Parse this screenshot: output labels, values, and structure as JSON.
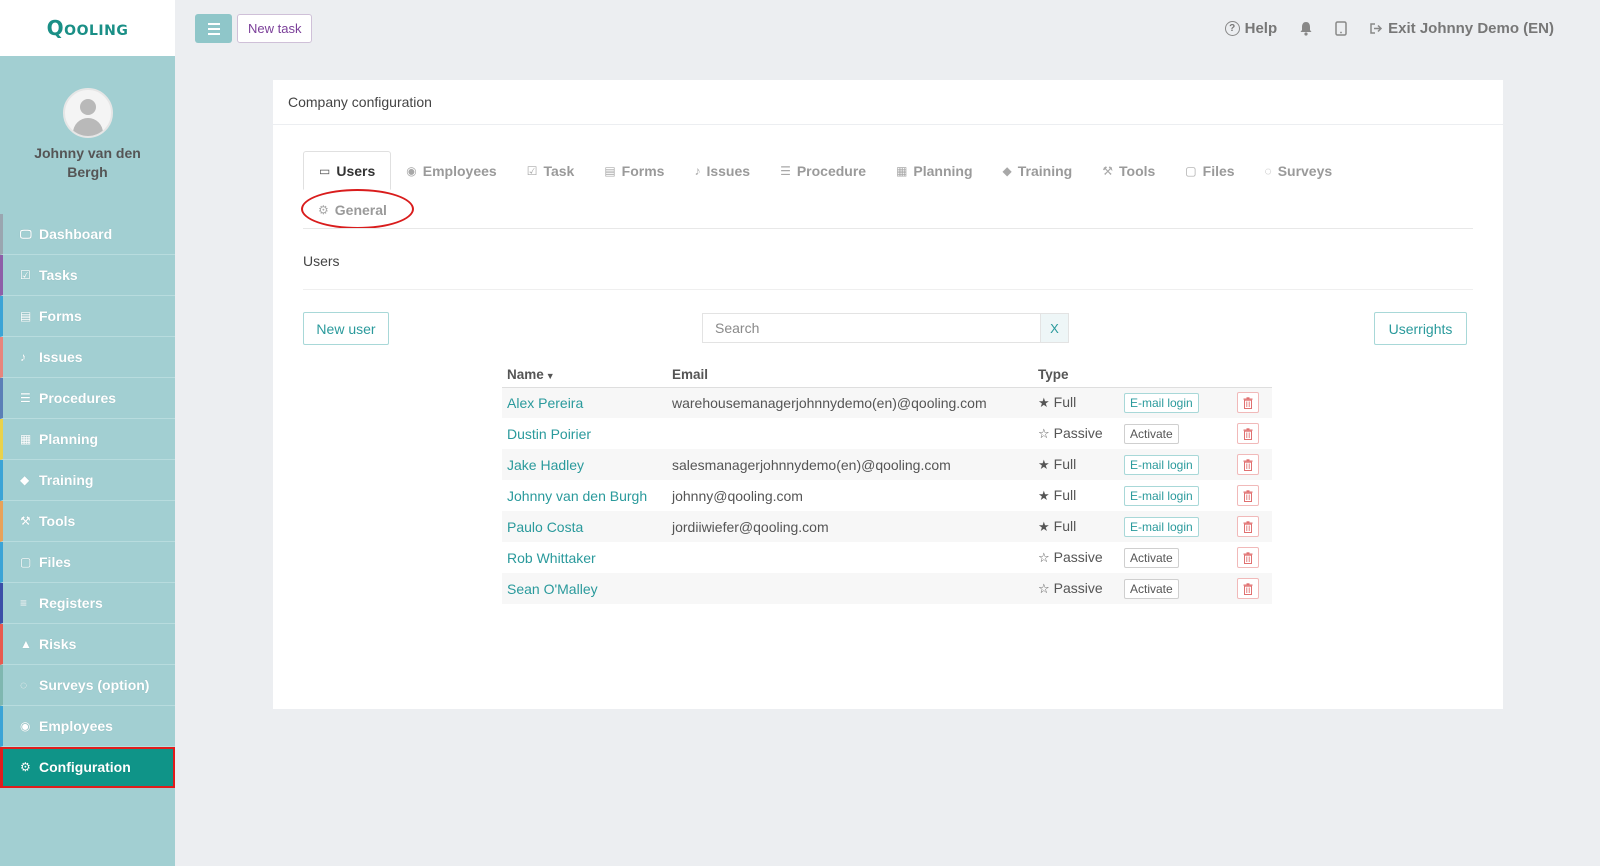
{
  "app": {
    "logo": "Qooling"
  },
  "profile": {
    "name": "Johnny van den Bergh"
  },
  "sidebar": {
    "items": [
      {
        "label": "Dashboard",
        "icon": "monitor-icon",
        "color": "#9aa6b0"
      },
      {
        "label": "Tasks",
        "icon": "check-square-icon",
        "color": "#8e5ea8"
      },
      {
        "label": "Forms",
        "icon": "document-icon",
        "color": "#3ba4d6"
      },
      {
        "label": "Issues",
        "icon": "bell-icon",
        "color": "#e8857c"
      },
      {
        "label": "Procedures",
        "icon": "list-icon",
        "color": "#5b7fb7"
      },
      {
        "label": "Planning",
        "icon": "calendar-icon",
        "color": "#e9d24b"
      },
      {
        "label": "Training",
        "icon": "graduation-cap-icon",
        "color": "#3ba4d6"
      },
      {
        "label": "Tools",
        "icon": "wrench-icon",
        "color": "#e8a25a"
      },
      {
        "label": "Files",
        "icon": "file-icon",
        "color": "#3ba4d6"
      },
      {
        "label": "Registers",
        "icon": "lines-icon",
        "color": "#3b4fa8"
      },
      {
        "label": "Risks",
        "icon": "warning-icon",
        "color": "#e85a4f"
      },
      {
        "label": "Surveys (option)",
        "icon": "chat-icon",
        "color": "#7fb7b0"
      },
      {
        "label": "Employees",
        "icon": "users-icon",
        "color": "#3ba4d6"
      },
      {
        "label": "Configuration",
        "icon": "gear-icon",
        "color": "#0f9488"
      }
    ]
  },
  "topbar": {
    "new_task": "New task",
    "help": "Help",
    "exit": "Exit Johnny Demo (EN)"
  },
  "panel": {
    "title": "Company configuration",
    "tabs": [
      {
        "label": "Users",
        "icon": "id-card-icon"
      },
      {
        "label": "Employees",
        "icon": "users-icon"
      },
      {
        "label": "Task",
        "icon": "check-square-icon"
      },
      {
        "label": "Forms",
        "icon": "document-icon"
      },
      {
        "label": "Issues",
        "icon": "bell-icon"
      },
      {
        "label": "Procedure",
        "icon": "list-icon"
      },
      {
        "label": "Planning",
        "icon": "calendar-icon"
      },
      {
        "label": "Training",
        "icon": "graduation-cap-icon"
      },
      {
        "label": "Tools",
        "icon": "wrench-icon"
      },
      {
        "label": "Files",
        "icon": "file-icon"
      },
      {
        "label": "Surveys",
        "icon": "chat-icon"
      },
      {
        "label": "General",
        "icon": "gear-icon"
      }
    ],
    "active_tab": "Users",
    "section_title": "Users",
    "new_user": "New user",
    "search": {
      "placeholder": "Search",
      "clear": "X"
    },
    "userrights": "Userrights",
    "table": {
      "headers": {
        "name": "Name",
        "email": "Email",
        "type": "Type"
      },
      "rows": [
        {
          "name": "Alex Pereira",
          "email": "warehousemanagerjohnnydemo(en)@qooling.com",
          "type": "Full",
          "action": "E-mail login"
        },
        {
          "name": "Dustin Poirier",
          "email": "",
          "type": "Passive",
          "action": "Activate"
        },
        {
          "name": "Jake Hadley",
          "email": "salesmanagerjohnnydemo(en)@qooling.com",
          "type": "Full",
          "action": "E-mail login"
        },
        {
          "name": "Johnny van den Burgh",
          "email": "johnny@qooling.com",
          "type": "Full",
          "action": "E-mail login"
        },
        {
          "name": "Paulo Costa",
          "email": "jordiiwiefer@qooling.com",
          "type": "Full",
          "action": "E-mail login"
        },
        {
          "name": "Rob Whittaker",
          "email": "",
          "type": "Passive",
          "action": "Activate"
        },
        {
          "name": "Sean O'Malley",
          "email": "",
          "type": "Passive",
          "action": "Activate"
        }
      ]
    }
  }
}
